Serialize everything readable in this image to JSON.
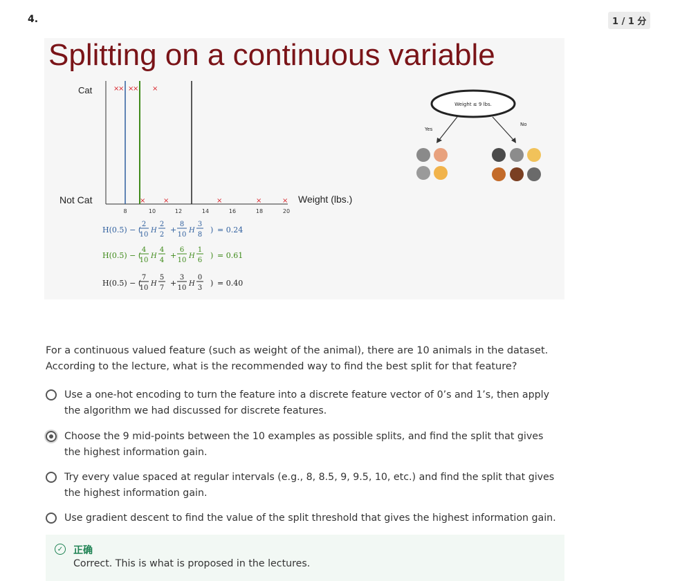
{
  "question": {
    "number": "4.",
    "score": "1 / 1 分",
    "text": "For a continuous valued feature (such as weight of the animal), there are 10 animals in the dataset. According to the lecture, what is the recommended way to find the best split for that feature?"
  },
  "figure": {
    "title": "Splitting on a continuous variable",
    "y_labels": [
      "Cat",
      "Not Cat"
    ],
    "x_axis_label": "Weight (lbs.)",
    "x_ticks": [
      "8",
      "10",
      "12",
      "14",
      "16",
      "18",
      "20"
    ],
    "marker": "×",
    "formulas": [
      {
        "prefix": "H(0.5) − (",
        "f1n": "2",
        "f1d": "10",
        "h1n": "2",
        "h1d": "2",
        "f2n": "8",
        "f2d": "10",
        "h2n": "3",
        "h2d": "8",
        "result": "= 0.24",
        "color": "#2f5f9e"
      },
      {
        "prefix": "H(0.5) − (",
        "f1n": "4",
        "f1d": "10",
        "h1n": "4",
        "h1d": "4",
        "f2n": "6",
        "f2d": "10",
        "h2n": "1",
        "h2d": "6",
        "result": "= 0.61",
        "color": "#3f8a1a"
      },
      {
        "prefix": "H(0.5) − (",
        "f1n": "7",
        "f1d": "10",
        "h1n": "5",
        "h1d": "7",
        "f2n": "3",
        "f2d": "10",
        "h2n": "0",
        "h2d": "3",
        "result": "= 0.40",
        "color": "#222222"
      }
    ],
    "tree": {
      "root": "Weight ≤ 9 lbs.",
      "yes": "Yes",
      "no": "No"
    }
  },
  "options": [
    {
      "text": "Use a one-hot encoding to turn the feature into a discrete feature vector of 0’s and 1’s, then apply the algorithm we had discussed for discrete features.",
      "selected": false
    },
    {
      "text": "Choose the 9 mid-points between the 10 examples as possible splits, and find the split that gives the highest information gain.",
      "selected": true
    },
    {
      "text": "Try every value spaced at regular intervals (e.g., 8, 8.5, 9, 9.5, 10, etc.) and find the split that gives the highest information gain.",
      "selected": false
    },
    {
      "text": "Use gradient descent to find the value of the split threshold that gives the highest information gain.",
      "selected": false
    }
  ],
  "feedback": {
    "status": "正确",
    "text": "Correct. This is what is proposed in the lectures.",
    "icon": "check-circle-icon"
  },
  "colors": {
    "title": "#7a1418",
    "correct": "#1f8354",
    "split1": "#2f5f9e",
    "split2": "#3f8a1a",
    "marker": "#d9262c"
  }
}
